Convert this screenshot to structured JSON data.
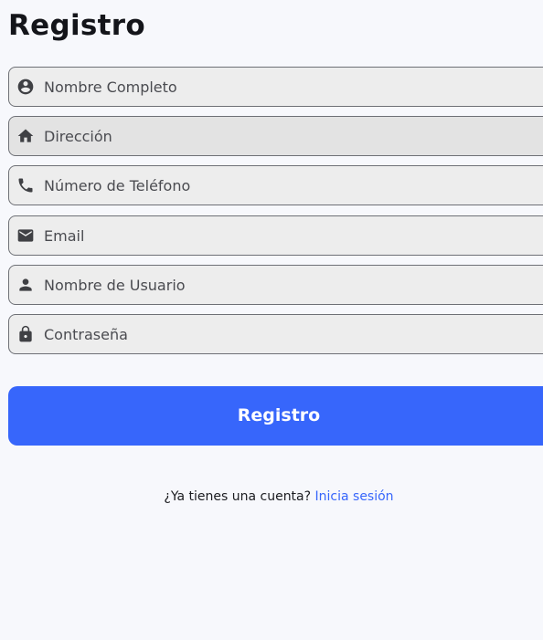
{
  "title": "Registro",
  "fields": [
    {
      "id": "full-name",
      "icon": "account-circle-icon",
      "placeholder": "Nombre Completo"
    },
    {
      "id": "address",
      "icon": "home-icon",
      "placeholder": "Dirección"
    },
    {
      "id": "phone",
      "icon": "phone-icon",
      "placeholder": "Número de Teléfono"
    },
    {
      "id": "email",
      "icon": "mail-icon",
      "placeholder": "Email"
    },
    {
      "id": "username",
      "icon": "person-icon",
      "placeholder": "Nombre de Usuario"
    },
    {
      "id": "password",
      "icon": "lock-icon",
      "placeholder": "Contraseña"
    }
  ],
  "submit_label": "Registro",
  "footer": {
    "prompt": "¿Ya tienes una cuenta?",
    "link": "Inicia sesión"
  },
  "colors": {
    "background": "#f7f8fc",
    "accent": "#3766fb",
    "field_fill": "#ededed",
    "field_border": "#6e7076"
  }
}
